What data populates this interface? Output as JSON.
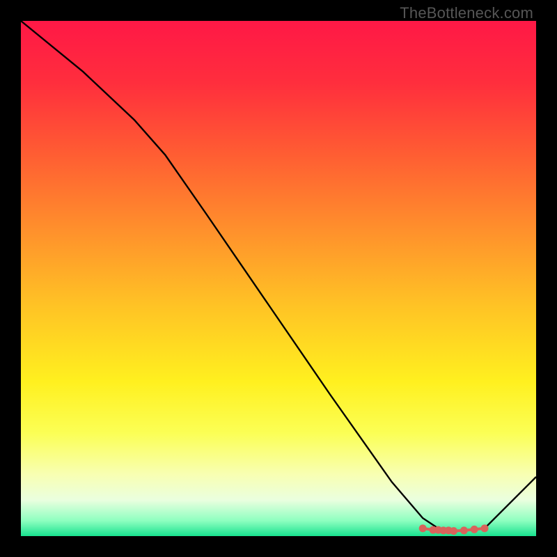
{
  "watermark": "TheBottleneck.com",
  "chart_data": {
    "type": "line",
    "title": "",
    "xlabel": "",
    "ylabel": "",
    "xlim": [
      0,
      100
    ],
    "ylim": [
      0,
      100
    ],
    "background_gradient": {
      "stops": [
        {
          "offset": 0.0,
          "color": "#ff1846"
        },
        {
          "offset": 0.12,
          "color": "#ff2e3d"
        },
        {
          "offset": 0.25,
          "color": "#ff5a33"
        },
        {
          "offset": 0.4,
          "color": "#ff8e2c"
        },
        {
          "offset": 0.55,
          "color": "#ffc225"
        },
        {
          "offset": 0.7,
          "color": "#fff01f"
        },
        {
          "offset": 0.8,
          "color": "#fbff55"
        },
        {
          "offset": 0.88,
          "color": "#f8ffb2"
        },
        {
          "offset": 0.93,
          "color": "#eaffdf"
        },
        {
          "offset": 0.97,
          "color": "#8effc0"
        },
        {
          "offset": 1.0,
          "color": "#18e28f"
        }
      ]
    },
    "series": [
      {
        "name": "curve",
        "color": "#000000",
        "points": [
          {
            "x": 0,
            "y": 100
          },
          {
            "x": 12,
            "y": 90.2
          },
          {
            "x": 22,
            "y": 80.8
          },
          {
            "x": 28,
            "y": 74.0
          },
          {
            "x": 36,
            "y": 62.5
          },
          {
            "x": 48,
            "y": 45.0
          },
          {
            "x": 60,
            "y": 27.5
          },
          {
            "x": 72,
            "y": 10.5
          },
          {
            "x": 78,
            "y": 3.5
          },
          {
            "x": 81,
            "y": 1.5
          },
          {
            "x": 85,
            "y": 1.0
          },
          {
            "x": 90,
            "y": 1.5
          },
          {
            "x": 100,
            "y": 11.5
          }
        ]
      }
    ],
    "markers": {
      "name": "optimal-zone",
      "color": "#d9635b",
      "points": [
        {
          "x": 78,
          "y": 1.5
        },
        {
          "x": 80,
          "y": 1.2
        },
        {
          "x": 81,
          "y": 1.2
        },
        {
          "x": 82,
          "y": 1.1
        },
        {
          "x": 83,
          "y": 1.1
        },
        {
          "x": 84,
          "y": 1.0
        },
        {
          "x": 86,
          "y": 1.1
        },
        {
          "x": 88,
          "y": 1.3
        },
        {
          "x": 90,
          "y": 1.5
        }
      ]
    }
  }
}
